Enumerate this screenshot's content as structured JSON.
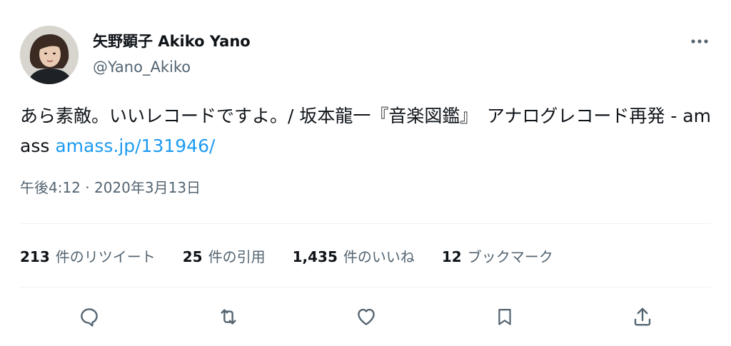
{
  "tweet": {
    "author": {
      "display_name": "矢野顕子 Akiko Yano",
      "handle": "@Yano_Akiko",
      "avatar_icon": "avatar-photo"
    },
    "text": "あら素敵。いいレコードですよ。/ 坂本龍一『音楽図鑑』　アナログレコード再発 - amass ",
    "link_text": "amass.jp/131946/",
    "timestamp": "午後4:12 · 2020年3月13日"
  },
  "stats": {
    "retweets": {
      "count": "213",
      "label": "件のリツイート"
    },
    "quotes": {
      "count": "25",
      "label": "件の引用"
    },
    "likes": {
      "count": "1,435",
      "label": "件のいいね"
    },
    "bookmarks": {
      "count": "12",
      "label": "ブックマーク"
    }
  },
  "actions": [
    "reply-icon",
    "retweet-icon",
    "like-icon",
    "bookmark-icon",
    "share-icon"
  ],
  "colors": {
    "text": "#0f1419",
    "secondary": "#536471",
    "link": "#1d9bf0",
    "divider": "#eff3f4"
  }
}
